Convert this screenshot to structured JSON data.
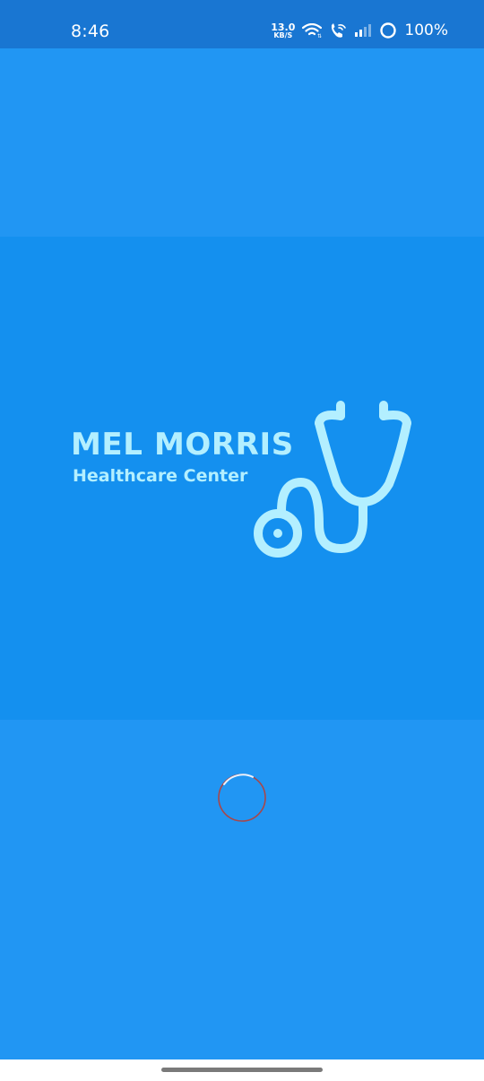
{
  "status_bar": {
    "time": "8:46",
    "net_speed_value": "13.0",
    "net_speed_unit": "KB/S",
    "battery_percent": "100%",
    "icons": [
      "wifi-icon",
      "wifi-calling-icon",
      "cell-signal-icon",
      "battery-icon"
    ]
  },
  "splash": {
    "brand_name": "MEL MORRIS",
    "brand_subtitle": "Healthcare Center",
    "logo_icon": "stethoscope-icon",
    "loading": "loading-spinner"
  },
  "colors": {
    "background": "#2196f3",
    "center_band": "#1490ef",
    "status_bar": "#1976d2",
    "logo": "#b3efff",
    "spinner_arc_light": "#e8f2ff",
    "spinner_arc_red": "#c0392b"
  }
}
